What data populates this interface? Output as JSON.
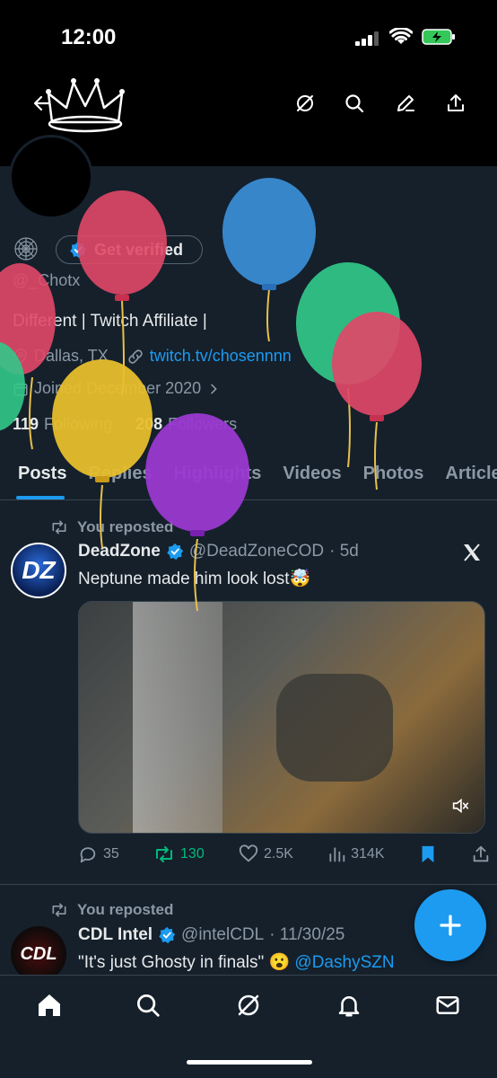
{
  "status": {
    "time": "12:00"
  },
  "profile": {
    "verify_label": "Get verified",
    "handle": "@_Chotx",
    "bio": "Different | Twitch Affiliate |",
    "location": "Dallas, TX",
    "link": "twitch.tv/chosennnn",
    "joined": "Joined December 2020",
    "following_count": "119",
    "following_label": "Following",
    "followers_count": "208",
    "followers_label": "Followers"
  },
  "tabs": [
    "Posts",
    "Replies",
    "Highlights",
    "Videos",
    "Photos",
    "Articles"
  ],
  "tweets": [
    {
      "repost_label": "You reposted",
      "name": "DeadZone",
      "handle": "@DeadZoneCOD",
      "time": "· 5d",
      "text": "Neptune made him look lost🤯",
      "avatar_text": "DZ",
      "replies": "35",
      "reposts": "130",
      "likes": "2.5K",
      "views": "314K"
    },
    {
      "repost_label": "You reposted",
      "name": "CDL Intel",
      "handle": "@intelCDL",
      "time": "· 11/30/25",
      "text": "\"It's just Ghosty in finals\" 😮",
      "mention": "@DashySZN",
      "avatar_text": "CDL"
    }
  ],
  "icons": {
    "back": "back-arrow-icon",
    "grok": "grok-icon",
    "search": "search-icon",
    "edit": "edit-icon",
    "share": "share-icon"
  },
  "colors": {
    "accent": "#1d9bf0",
    "background": "#15202b",
    "repost_green": "#00ba7c"
  }
}
